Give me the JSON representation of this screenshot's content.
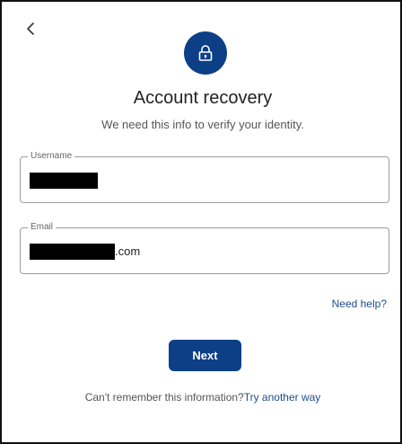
{
  "colors": {
    "brand": "#1f4e8c",
    "primary_button": "#0d3f86",
    "lock_badge": "#0d3f86"
  },
  "icons": {
    "back": "chevron-left-icon",
    "lock": "lock-icon"
  },
  "header": {
    "title": "Account recovery",
    "subtitle": "We need this info to verify your identity."
  },
  "form": {
    "username": {
      "label": "Username",
      "value_redacted": true
    },
    "email": {
      "label": "Email",
      "value_suffix": ".com",
      "value_redacted": true
    }
  },
  "links": {
    "need_help": "Need help?"
  },
  "actions": {
    "next_label": "Next"
  },
  "footer": {
    "prompt": "Can't remember this information?",
    "link": "Try another way"
  }
}
